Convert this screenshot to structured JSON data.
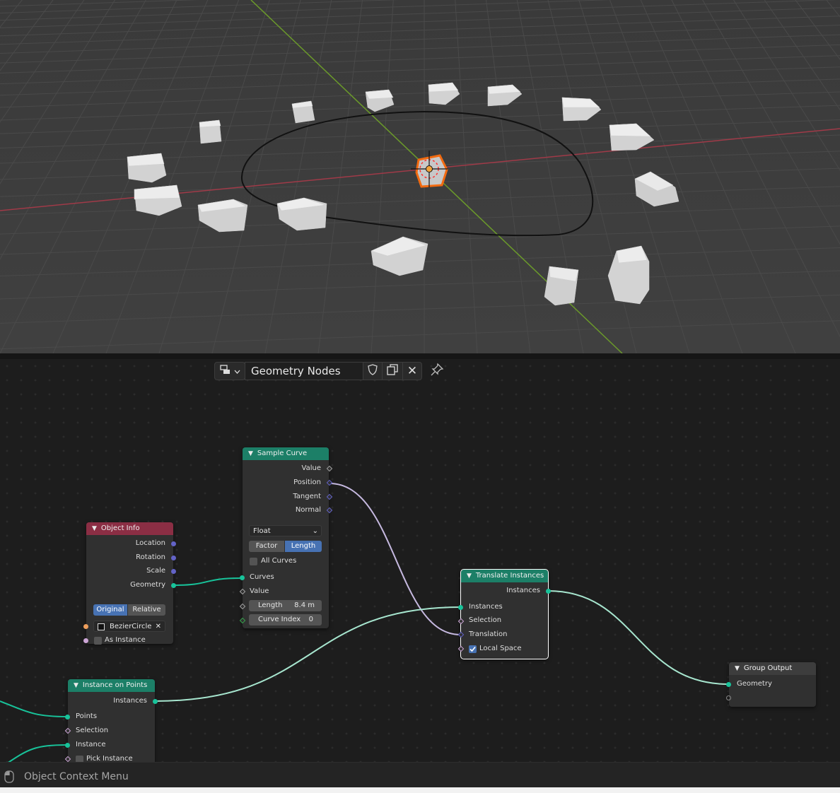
{
  "node_group_header": {
    "name": "Geometry Nodes",
    "browse_icon": "node-tree-icon",
    "fake_user_icon": "shield-icon",
    "duplicate_icon": "duplicate-icon",
    "close_icon": "close-icon",
    "close_glyph": "✕",
    "pin_icon": "pin-icon"
  },
  "nodes": {
    "sample_curve": {
      "title": "Sample Curve",
      "outputs": [
        "Value",
        "Position",
        "Tangent",
        "Normal"
      ],
      "data_type": "Float",
      "mode_options": [
        "Factor",
        "Length"
      ],
      "mode_selected": "Length",
      "all_curves_label": "All Curves",
      "all_curves_checked": false,
      "inputs": {
        "curves": "Curves",
        "value": "Value",
        "length_label": "Length",
        "length_value": "8.4 m",
        "curve_index_label": "Curve Index",
        "curve_index_value": "0"
      }
    },
    "object_info": {
      "title": "Object Info",
      "outputs": [
        "Location",
        "Rotation",
        "Scale",
        "Geometry"
      ],
      "transform_options": [
        "Original",
        "Relative"
      ],
      "transform_selected": "Original",
      "object_value": "BezierCircle",
      "as_instance_label": "As Instance"
    },
    "translate_instances": {
      "title": "Translate Instances",
      "output": "Instances",
      "inputs": [
        "Instances",
        "Selection",
        "Translation"
      ],
      "local_space_label": "Local Space",
      "local_space_checked": true
    },
    "group_output": {
      "title": "Group Output",
      "inputs": [
        "Geometry"
      ]
    },
    "instance_on_points": {
      "title": "Instance on Points",
      "output": "Instances",
      "inputs": [
        "Points",
        "Selection",
        "Instance"
      ],
      "pick_instance_label": "Pick Instance"
    }
  },
  "status_bar": {
    "icon": "mouse-icon",
    "text": "Object Context Menu"
  },
  "colors": {
    "geometry_socket": "#18c39a",
    "vector_socket": "#6363c7",
    "object_socket": "#ed9e5c",
    "boolean_socket": "#cca6d6",
    "selected_option": "#4772b3",
    "geometry_header": "#1c7f67",
    "input_header": "#8b2e44"
  }
}
